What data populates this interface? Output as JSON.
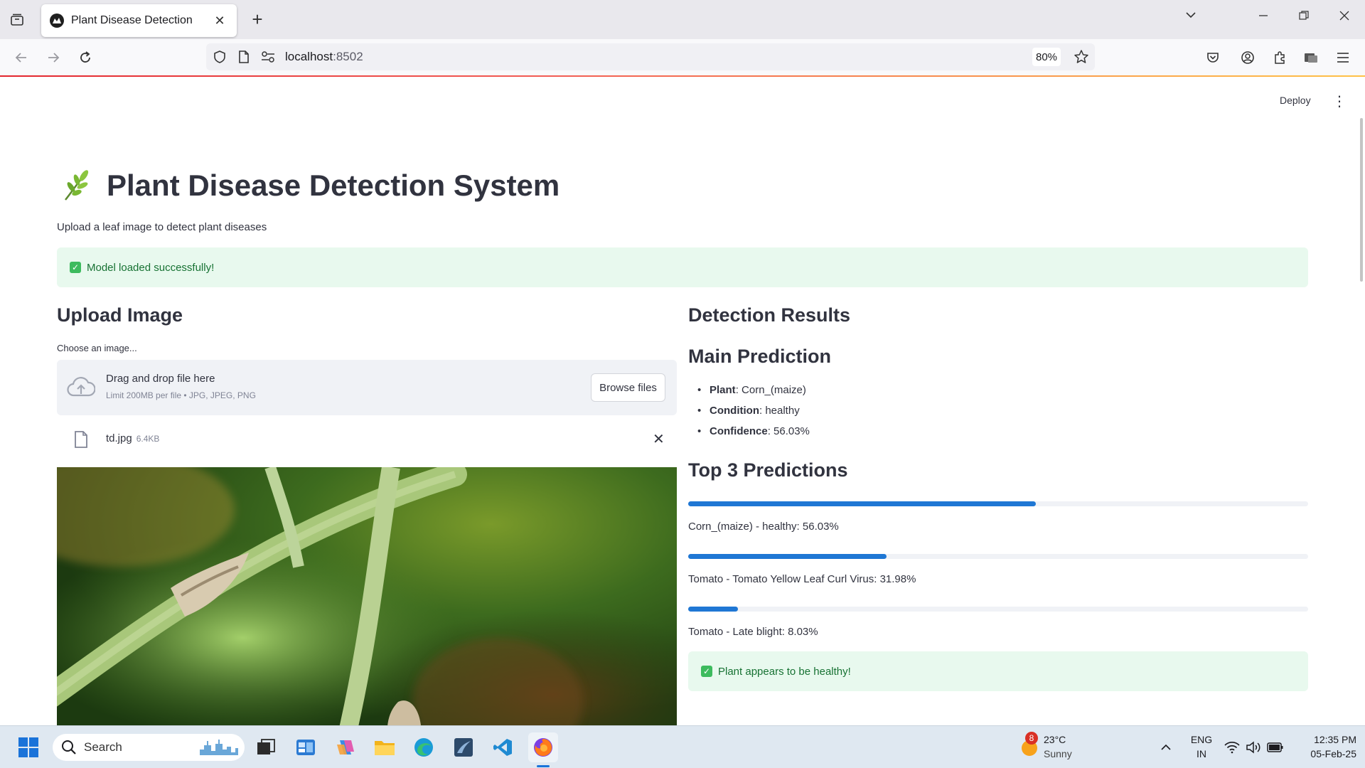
{
  "browser": {
    "tab_title": "Plant Disease Detection",
    "url_host": "localhost",
    "url_port": ":8502",
    "zoom": "80%"
  },
  "app": {
    "deploy_label": "Deploy",
    "title": "Plant Disease Detection System",
    "subtitle": "Upload a leaf image to detect plant diseases",
    "model_status": "Model loaded successfully!"
  },
  "upload": {
    "heading": "Upload Image",
    "label": "Choose an image...",
    "drag_text": "Drag and drop file here",
    "limit_text": "Limit 200MB per file • JPG, JPEG, PNG",
    "browse_label": "Browse files",
    "file_name": "td.jpg",
    "file_size": "6.4KB"
  },
  "results": {
    "heading": "Detection Results",
    "main_heading": "Main Prediction",
    "items": [
      {
        "key": "Plant",
        "value": ": Corn_(maize)"
      },
      {
        "key": "Condition",
        "value": ": healthy"
      },
      {
        "key": "Confidence",
        "value": ": 56.03%"
      }
    ],
    "top_heading": "Top 3 Predictions",
    "top": [
      {
        "label": "Corn_(maize) - healthy: 56.03%",
        "value": 0.5603
      },
      {
        "label": "Tomato - Tomato Yellow Leaf Curl Virus: 31.98%",
        "value": 0.3198
      },
      {
        "label": "Tomato - Late blight: 8.03%",
        "value": 0.0803
      }
    ],
    "health_status": "Plant appears to be healthy!"
  },
  "colors": {
    "accent": "#1f77d4",
    "success_bg": "#e8f9ee",
    "success_text": "#177233"
  },
  "taskbar": {
    "search_placeholder": "Search",
    "weather_badge": "8",
    "temperature": "23°C",
    "weather": "Sunny",
    "lang_top": "ENG",
    "lang_bottom": "IN",
    "time": "12:35 PM",
    "date": "05-Feb-25"
  }
}
